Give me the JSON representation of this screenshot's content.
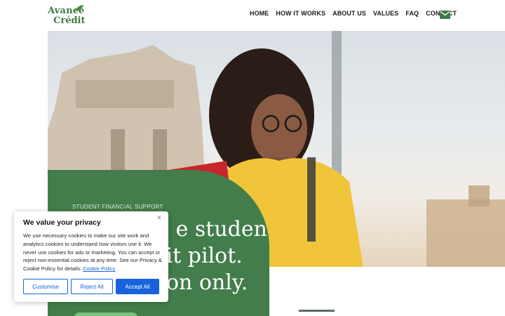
{
  "brand": {
    "line1": "Avance",
    "line2": "Crédit",
    "color": "#3e7a48"
  },
  "nav": {
    "items": [
      "HOME",
      "HOW IT WORKS",
      "ABOUT US",
      "VALUES",
      "FAQ",
      "CONTACT"
    ],
    "mail_icon": "envelope-icon"
  },
  "hero": {
    "eyebrow": "STUDENT FINANCIAL SUPPORT",
    "headline_lines": [
      "e student",
      "lit pilot.",
      "on only."
    ],
    "card_color": "#437d4b"
  },
  "cookie": {
    "title": "We value your privacy",
    "body": "We use necessary cookies to make our site work and analytics cookies to understand how visitors use it. We never use cookies for ads or marketing. You can accept or reject non-essential cookies at any time. See our Privacy & Cookie Policy for details.",
    "link_label": "Cookie Policy",
    "close_label": "×",
    "buttons": {
      "customise": "Customise",
      "reject": "Reject All",
      "accept": "Accept All"
    },
    "accent": "#1863dc"
  }
}
